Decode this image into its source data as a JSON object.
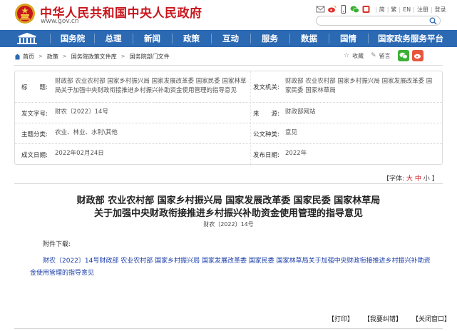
{
  "header": {
    "site_name": "中华人民共和国中央人民政府",
    "site_url": "www.gov.cn",
    "toplinks": {
      "simplified": "简",
      "traditional": "繁",
      "english": "EN",
      "register": "注册",
      "login": "登录"
    },
    "search": {
      "placeholder": ""
    }
  },
  "nav": {
    "items": [
      "国务院",
      "总理",
      "新闻",
      "政策",
      "互动",
      "服务",
      "数据",
      "国情",
      "国家政务服务平台"
    ]
  },
  "breadcrumb": {
    "items": [
      "首页",
      "政策",
      "国务院政策文件库",
      "国务院部门文件"
    ]
  },
  "share": {
    "favorite": "收藏",
    "comment": "留言"
  },
  "info": {
    "title_label": "标　　题:",
    "title_value": "财政部 农业农村部 国家乡村振兴局 国家发展改革委 国家民委 国家林草局关于加强中央财政衔接推进乡村振兴补助资金使用管理的指导意见",
    "issuer_label": "发文机关:",
    "issuer_value": "财政部 农业农村部 国家乡村振兴局 国家发展改革委 国家民委 国家林草局",
    "docno_label": "发文字号:",
    "docno_value": "财农〔2022〕14号",
    "source_label": "来　　源:",
    "source_value": "财政部网站",
    "topic_label": "主题分类:",
    "topic_value": "农业、林业、水利\\其他",
    "type_label": "公文种类:",
    "type_value": "意见",
    "written_label": "成文日期:",
    "written_value": "2022年02月24日",
    "published_label": "发布日期:",
    "published_value": "2022年"
  },
  "fontsize": {
    "label": "【字体:",
    "large": "大",
    "medium": "中",
    "small": "小",
    "close": "】"
  },
  "article": {
    "title_line1": "财政部 农业农村部 国家乡村振兴局 国家发展改革委 国家民委 国家林草局",
    "title_line2": "关于加强中央财政衔接推进乡村振兴补助资金使用管理的指导意见",
    "doc_number": "财农〔2022〕14号",
    "attachment_label": "附件下载:",
    "attachment_link": "财农〔2022〕14号财政部 农业农村部 国家乡村振兴局 国家发展改革委 国家民委 国家林草局关于加强中央财政衔接推进乡村振兴补助资金使用管理的指导意见"
  },
  "actions": {
    "print": "【打印】",
    "report": "【我要纠错】",
    "close": "【关闭窗口】"
  },
  "colors": {
    "brand_red": "#c8161d",
    "nav_blue": "#2b69b3",
    "link_blue": "#1a3da8"
  }
}
